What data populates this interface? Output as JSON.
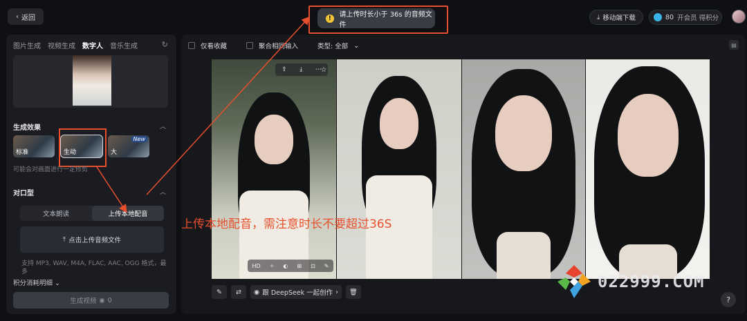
{
  "header": {
    "back_label": "返回",
    "toast_text": "请上传时长小于 36s 的音频文件",
    "mobile_download": "移动端下载",
    "points": "80",
    "vip_text": "开会员 得积分",
    "toast_icon": "warning-icon"
  },
  "left": {
    "tabs": [
      {
        "label": "图片生成"
      },
      {
        "label": "视频生成"
      },
      {
        "label": "数字人"
      },
      {
        "label": "音乐生成"
      }
    ],
    "effect": {
      "title": "生成效果",
      "options": [
        {
          "label": "标准"
        },
        {
          "label": "生动"
        },
        {
          "label": "大"
        }
      ],
      "new_badge": "New",
      "hint": "可能会对画面进行一定修剪"
    },
    "lipsync": {
      "title": "对口型",
      "seg_read": "文本朗读",
      "seg_upload": "上传本地配音",
      "upload_button": "点击上传音频文件",
      "formats": "支持 MP3, WAV, M4A, FLAC, AAC, OGG 格式，最多"
    },
    "cost_label": "积分消耗明细",
    "generate_label": "生成视频",
    "generate_cost": "0"
  },
  "main": {
    "filter_fav": "仅看收藏",
    "filter_merge": "聚合相同输入",
    "filter_type": "类型: 全部",
    "photo_tools_bottom_hd": "HD",
    "deepseek_label": "跟 DeepSeek 一起创作"
  },
  "annotation": {
    "text": "上传本地配音，需注意时长不要超过36S",
    "color": "#e8502d"
  },
  "watermark": {
    "text": "022999.COM"
  }
}
